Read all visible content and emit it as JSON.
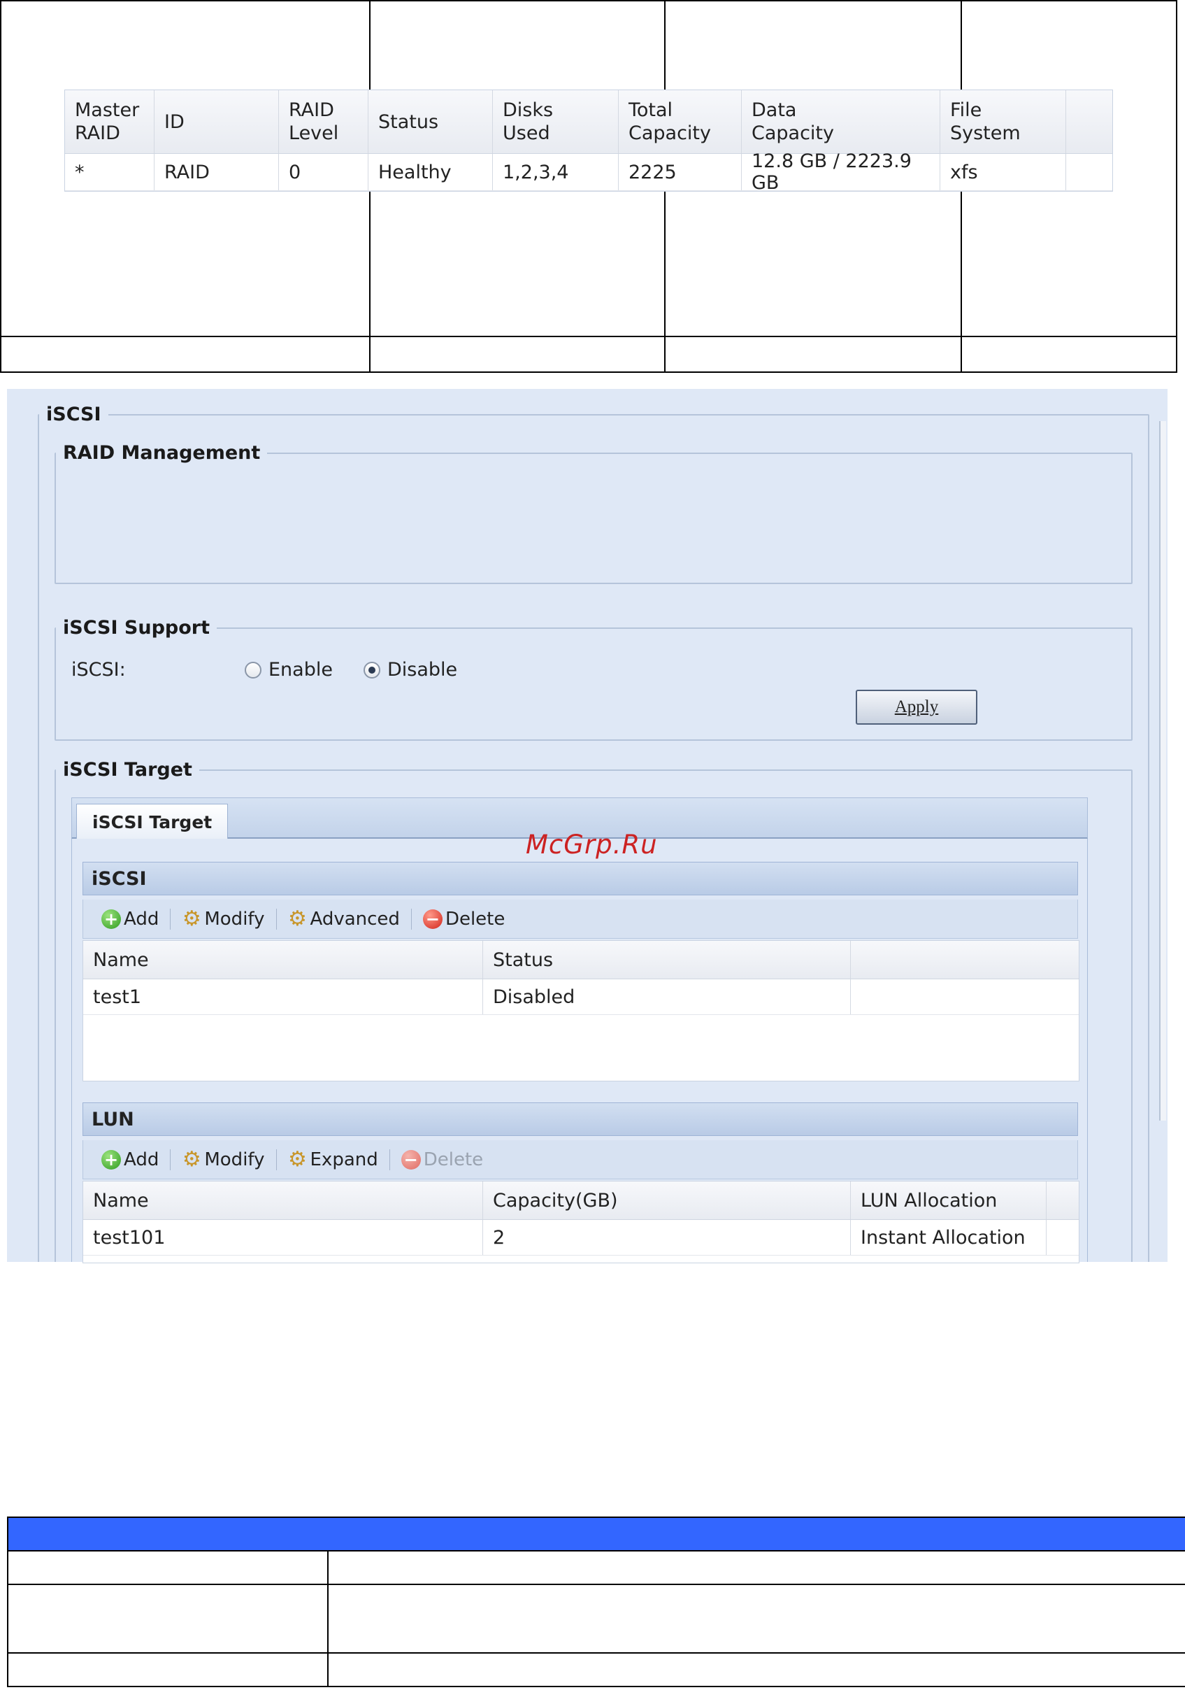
{
  "iscsi_section": {
    "legend": "iSCSI",
    "raid_management": {
      "legend": "RAID Management",
      "columns": [
        "Master\nRAID",
        "ID",
        "RAID\nLevel",
        "Status",
        "Disks\nUsed",
        "Total\nCapacity",
        "Data\nCapacity",
        "File System"
      ],
      "rows": [
        [
          "*",
          "RAID",
          "0",
          "Healthy",
          "1,2,3,4",
          "2225",
          "12.8 GB / 2223.9 GB",
          "xfs"
        ]
      ]
    },
    "iscsi_support": {
      "legend": "iSCSI Support",
      "label": "iSCSI:",
      "options": [
        "Enable",
        "Disable"
      ],
      "selected": "Disable",
      "apply_label": "Apply"
    },
    "iscsi_target": {
      "legend": "iSCSI Target",
      "tab_label": "iSCSI Target",
      "iscsi_panel": {
        "title": "iSCSI",
        "toolbar": [
          "Add",
          "Modify",
          "Advanced",
          "Delete"
        ],
        "columns": [
          "Name",
          "Status"
        ],
        "rows": [
          [
            "test1",
            "Disabled"
          ]
        ]
      },
      "lun_panel": {
        "title": "LUN",
        "toolbar": [
          "Add",
          "Modify",
          "Expand",
          "Delete"
        ],
        "delete_disabled": true,
        "columns": [
          "Name",
          "Capacity(GB)",
          "LUN Allocation"
        ],
        "rows": [
          [
            "test101",
            "2",
            "Instant Allocation"
          ]
        ]
      }
    }
  },
  "watermark": "McGrp.Ru",
  "colors": {
    "panel_bg": "#dfe8f6",
    "table_header_blue": "#3366ff",
    "watermark": "#cc2222"
  }
}
